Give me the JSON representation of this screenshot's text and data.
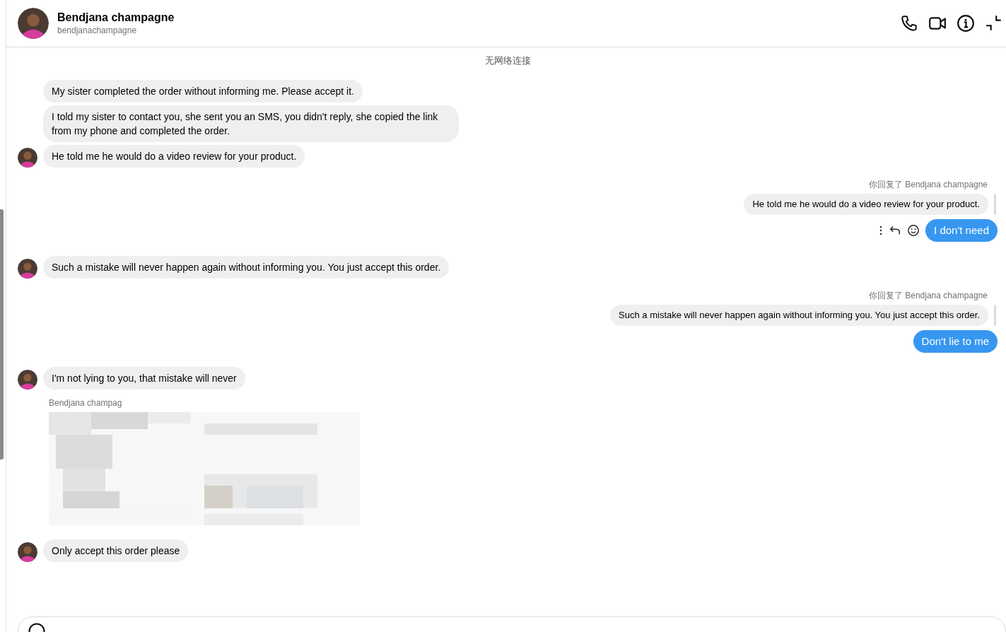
{
  "header": {
    "name": "Bendjana champagne",
    "username": "bendjanachampagne"
  },
  "status": "无网络连接",
  "messages": [
    {
      "kind": "incoming",
      "text": "My sister completed the order without informing me. Please accept it.",
      "show_avatar": false
    },
    {
      "kind": "incoming",
      "text": "I told my sister to contact you, she sent you an SMS, you didn't reply, she copied the link from my phone and completed the order.",
      "show_avatar": false
    },
    {
      "kind": "incoming",
      "text": "He told me he would do a video review for your product.",
      "show_avatar": true
    },
    {
      "kind": "outgoing",
      "reply_label": "你回复了 Bendjana champagne",
      "quote": "He told me he would do a video review for your product.",
      "text": "I don't need",
      "actions": true
    },
    {
      "kind": "incoming",
      "text": "Such a mistake will never happen again without informing you. You just accept this order.",
      "show_avatar": true
    },
    {
      "kind": "outgoing",
      "reply_label": "你回复了 Bendjana champagne",
      "quote": "Such a mistake will never happen again without informing you. You just accept this order.",
      "text": "Don't lie to me",
      "actions": false
    },
    {
      "kind": "incoming",
      "text": "I'm not lying to you, that mistake will never",
      "show_avatar": true
    },
    {
      "kind": "incoming_reply",
      "reply_label": "Bendjana champag"
    },
    {
      "kind": "incoming",
      "text": "Only accept this order please",
      "show_avatar": true
    }
  ]
}
